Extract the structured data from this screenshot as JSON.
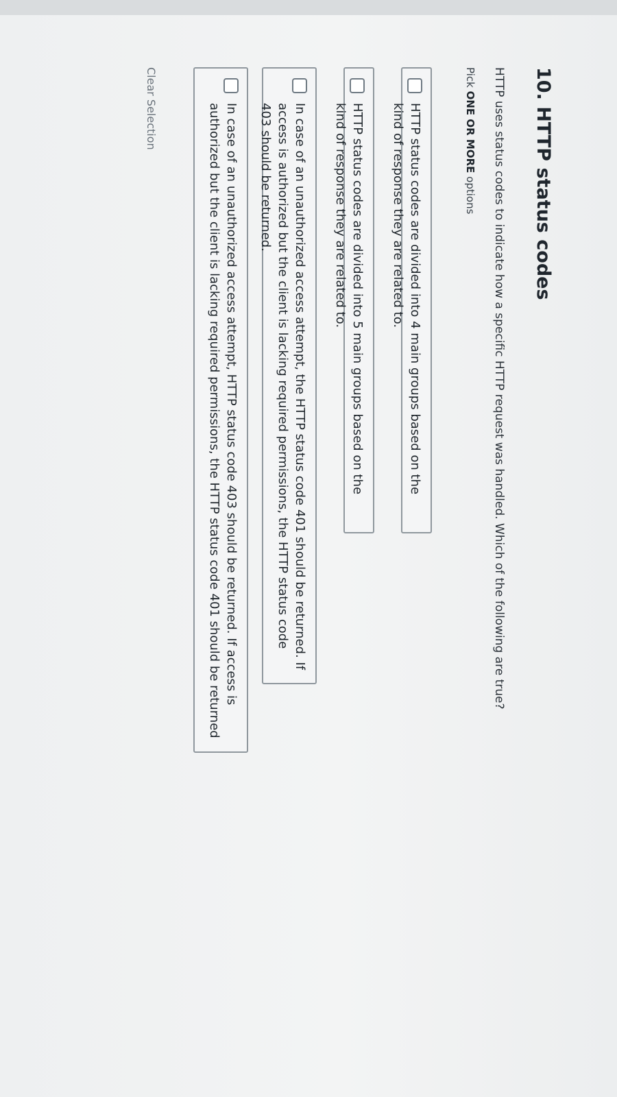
{
  "question": {
    "title": "10. HTTP status codes",
    "prompt": "HTTP uses status codes to indicate how a specific HTTP request was handled. Which of the following are true?",
    "pick_prefix": "Pick ",
    "pick_emphasis": "ONE OR MORE",
    "pick_suffix": " options"
  },
  "options": [
    {
      "label": "HTTP status codes are divided into 4 main groups based on the kind of response they are related to.",
      "checked": false
    },
    {
      "label": "HTTP status codes are divided into 5 main groups based on the kind of response they are related to.",
      "checked": false
    },
    {
      "label": "In case of an unauthorized access attempt, the HTTP status code 401 should be returned. If access is authorized but the client is lacking required permissions, the HTTP status code 403 should be returned.",
      "checked": false
    },
    {
      "label": "In case of an unauthorized access attempt, HTTP status code 403 should be returned. If access is authorized but the client is lacking required permissions, the HTTP status code 401 should be returned",
      "checked": false
    }
  ],
  "clear_selection_label": "Clear Selection"
}
